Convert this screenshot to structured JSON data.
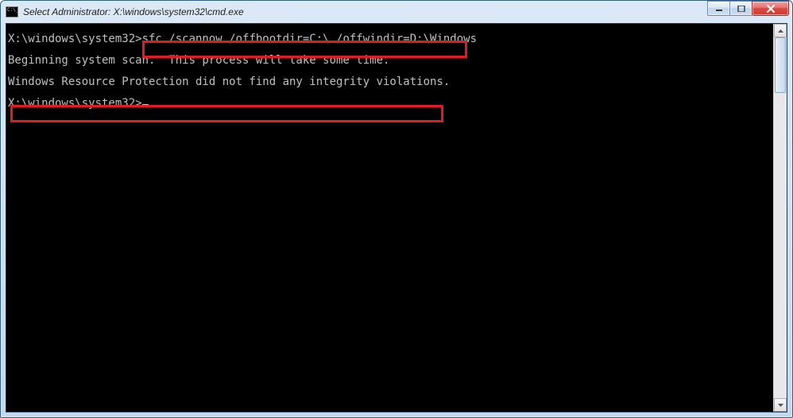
{
  "window": {
    "title": "Select Administrator: X:\\windows\\system32\\cmd.exe"
  },
  "console": {
    "prompt1": "X:\\windows\\system32>",
    "command": "sfc /scannow /offbootdir=C:\\ /offwindir=D:\\Windows",
    "line_blank1": "",
    "line_scan": "Beginning system scan.  This process will take some time.",
    "line_blank2": "",
    "line_result": "Windows Resource Protection did not find any integrity violations.",
    "line_blank3": "",
    "prompt2": "X:\\windows\\system32>"
  }
}
